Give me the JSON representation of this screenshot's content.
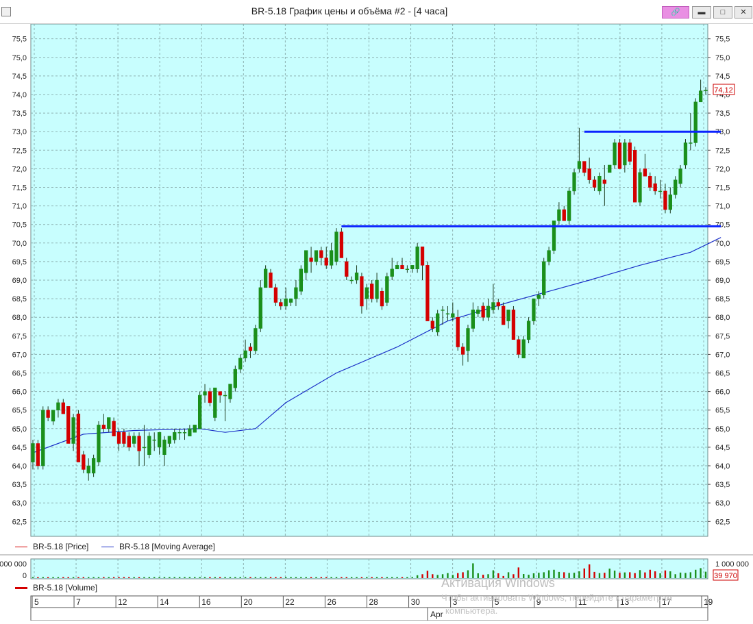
{
  "window": {
    "title": "BR-5.18 График цены и объёма #2 - [4 часа]",
    "link_icon": "link-icon",
    "min_icon": "minimize-icon",
    "max_icon": "maximize-icon",
    "close_icon": "close-icon"
  },
  "colors": {
    "plot_bg": "#c8fefe",
    "grid": "#7f9f9f",
    "up": "#1b8f1b",
    "down": "#d40000",
    "ma": "#1a2fc7",
    "level": "#0a22ff",
    "price_tag": "#cc0000"
  },
  "legend": {
    "price": "BR-5.18 [Price]",
    "ma": "BR-5.18 [Moving Average]",
    "volume": "BR-5.18 [Volume]"
  },
  "price_tag": "74,12",
  "volume_axis": {
    "top": "1 000 000",
    "zero": "0",
    "left_top": "000 000",
    "left_zero": "0"
  },
  "volume_tag": "39 970",
  "x_axis": {
    "labels": [
      "5",
      "7",
      "12",
      "14",
      "16",
      "20",
      "22",
      "26",
      "28",
      "30",
      "3",
      "5",
      "9",
      "11",
      "13",
      "17",
      "19"
    ],
    "month": "Apr"
  },
  "watermark": {
    "line1": "Активация Windows",
    "line2": "Чтобы активировать Windows, перейдите к параметрам",
    "line3": "компьютера."
  },
  "chart_data": {
    "type": "candlestick",
    "title": "BR-5.18 График цены и объёма #2 - [4 часа]",
    "ylim": [
      62.1,
      75.9
    ],
    "yticks": [
      "62,5",
      "63,0",
      "63,5",
      "64,0",
      "64,5",
      "65,0",
      "65,5",
      "66,0",
      "66,5",
      "67,0",
      "67,5",
      "68,0",
      "68,5",
      "69,0",
      "69,5",
      "70,0",
      "70,5",
      "71,0",
      "71,5",
      "72,0",
      "72,5",
      "73,0",
      "73,5",
      "74,0",
      "74,5",
      "75,0",
      "75,5"
    ],
    "grid": true,
    "candles": [
      {
        "o": 64.1,
        "h": 64.7,
        "l": 63.9,
        "c": 64.6
      },
      {
        "o": 64.6,
        "h": 64.7,
        "l": 63.9,
        "c": 64.0
      },
      {
        "o": 64.0,
        "h": 65.6,
        "l": 63.9,
        "c": 65.5
      },
      {
        "o": 65.5,
        "h": 65.6,
        "l": 65.2,
        "c": 65.3
      },
      {
        "o": 65.2,
        "h": 65.5,
        "l": 65.1,
        "c": 65.5
      },
      {
        "o": 65.5,
        "h": 65.8,
        "l": 65.3,
        "c": 65.7
      },
      {
        "o": 65.7,
        "h": 65.8,
        "l": 65.4,
        "c": 65.4
      },
      {
        "o": 65.6,
        "h": 65.6,
        "l": 64.6,
        "c": 64.6
      },
      {
        "o": 64.6,
        "h": 65.4,
        "l": 64.4,
        "c": 65.3
      },
      {
        "o": 65.4,
        "h": 65.5,
        "l": 64.1,
        "c": 64.1
      },
      {
        "o": 64.3,
        "h": 64.4,
        "l": 63.8,
        "c": 63.9
      },
      {
        "o": 63.8,
        "h": 64.2,
        "l": 63.6,
        "c": 64.0
      },
      {
        "o": 63.8,
        "h": 64.3,
        "l": 63.7,
        "c": 64.2
      },
      {
        "o": 64.1,
        "h": 65.2,
        "l": 64.0,
        "c": 65.1
      },
      {
        "o": 65.1,
        "h": 65.4,
        "l": 64.9,
        "c": 65.0
      },
      {
        "o": 65.0,
        "h": 65.3,
        "l": 64.9,
        "c": 65.3
      },
      {
        "o": 65.2,
        "h": 65.3,
        "l": 64.8,
        "c": 64.8
      },
      {
        "o": 64.9,
        "h": 65.0,
        "l": 64.4,
        "c": 64.6
      },
      {
        "o": 64.9,
        "h": 65.0,
        "l": 64.5,
        "c": 64.6
      },
      {
        "o": 64.8,
        "h": 64.9,
        "l": 64.4,
        "c": 64.5
      },
      {
        "o": 64.6,
        "h": 64.9,
        "l": 64.5,
        "c": 64.8
      },
      {
        "o": 64.8,
        "h": 64.9,
        "l": 64.0,
        "c": 64.4
      },
      {
        "o": 64.5,
        "h": 65.1,
        "l": 64.0,
        "c": 64.5
      },
      {
        "o": 64.3,
        "h": 64.9,
        "l": 64.2,
        "c": 64.8
      },
      {
        "o": 64.7,
        "h": 64.9,
        "l": 64.4,
        "c": 64.7
      },
      {
        "o": 64.5,
        "h": 64.9,
        "l": 64.3,
        "c": 64.9
      },
      {
        "o": 64.3,
        "h": 64.8,
        "l": 64.0,
        "c": 64.7
      },
      {
        "o": 64.6,
        "h": 64.8,
        "l": 64.5,
        "c": 64.8
      },
      {
        "o": 64.7,
        "h": 65.0,
        "l": 64.6,
        "c": 64.9
      },
      {
        "o": 64.9,
        "h": 65.0,
        "l": 64.7,
        "c": 64.9
      },
      {
        "o": 64.9,
        "h": 65.0,
        "l": 64.7,
        "c": 64.9
      },
      {
        "o": 64.8,
        "h": 65.1,
        "l": 64.8,
        "c": 65.0
      },
      {
        "o": 64.9,
        "h": 65.1,
        "l": 64.9,
        "c": 65.1
      },
      {
        "o": 65.0,
        "h": 66.0,
        "l": 65.0,
        "c": 65.9
      },
      {
        "o": 65.9,
        "h": 66.2,
        "l": 65.7,
        "c": 66.0
      },
      {
        "o": 66.0,
        "h": 66.1,
        "l": 65.6,
        "c": 65.7
      },
      {
        "o": 65.3,
        "h": 66.1,
        "l": 65.2,
        "c": 66.1
      },
      {
        "o": 66.0,
        "h": 66.0,
        "l": 65.7,
        "c": 65.9
      },
      {
        "o": 65.9,
        "h": 66.0,
        "l": 65.2,
        "c": 65.9
      },
      {
        "o": 65.8,
        "h": 66.2,
        "l": 65.7,
        "c": 66.2
      },
      {
        "o": 66.1,
        "h": 66.7,
        "l": 66.0,
        "c": 66.6
      },
      {
        "o": 66.6,
        "h": 67.0,
        "l": 66.5,
        "c": 66.9
      },
      {
        "o": 66.9,
        "h": 67.4,
        "l": 66.8,
        "c": 67.1
      },
      {
        "o": 67.2,
        "h": 67.3,
        "l": 66.9,
        "c": 67.1
      },
      {
        "o": 67.1,
        "h": 67.8,
        "l": 67.0,
        "c": 67.7
      },
      {
        "o": 67.7,
        "h": 69.0,
        "l": 67.6,
        "c": 68.8
      },
      {
        "o": 68.8,
        "h": 69.4,
        "l": 68.8,
        "c": 69.3
      },
      {
        "o": 69.2,
        "h": 69.3,
        "l": 68.8,
        "c": 68.8
      },
      {
        "o": 68.8,
        "h": 68.9,
        "l": 68.3,
        "c": 68.4
      },
      {
        "o": 68.4,
        "h": 68.5,
        "l": 68.2,
        "c": 68.3
      },
      {
        "o": 68.3,
        "h": 68.8,
        "l": 68.2,
        "c": 68.5
      },
      {
        "o": 68.4,
        "h": 68.5,
        "l": 68.3,
        "c": 68.5
      },
      {
        "o": 68.5,
        "h": 69.0,
        "l": 68.3,
        "c": 68.8
      },
      {
        "o": 68.7,
        "h": 69.4,
        "l": 68.6,
        "c": 69.3
      },
      {
        "o": 69.2,
        "h": 69.8,
        "l": 69.0,
        "c": 69.8
      },
      {
        "o": 69.6,
        "h": 69.9,
        "l": 69.2,
        "c": 69.5
      },
      {
        "o": 69.5,
        "h": 69.8,
        "l": 69.4,
        "c": 69.8
      },
      {
        "o": 69.8,
        "h": 69.9,
        "l": 69.4,
        "c": 69.6
      },
      {
        "o": 69.6,
        "h": 69.9,
        "l": 69.3,
        "c": 69.4
      },
      {
        "o": 69.4,
        "h": 70.0,
        "l": 69.3,
        "c": 69.8
      },
      {
        "o": 69.5,
        "h": 70.4,
        "l": 69.4,
        "c": 70.3
      },
      {
        "o": 70.3,
        "h": 70.4,
        "l": 69.6,
        "c": 69.6
      },
      {
        "o": 69.5,
        "h": 69.6,
        "l": 69.0,
        "c": 69.1
      },
      {
        "o": 69.0,
        "h": 69.1,
        "l": 68.9,
        "c": 69.0
      },
      {
        "o": 69.0,
        "h": 69.4,
        "l": 68.9,
        "c": 69.2
      },
      {
        "o": 69.1,
        "h": 69.2,
        "l": 68.1,
        "c": 68.3
      },
      {
        "o": 68.5,
        "h": 68.9,
        "l": 68.2,
        "c": 68.8
      },
      {
        "o": 68.9,
        "h": 69.0,
        "l": 68.4,
        "c": 68.5
      },
      {
        "o": 68.5,
        "h": 69.2,
        "l": 68.4,
        "c": 69.0
      },
      {
        "o": 68.7,
        "h": 68.8,
        "l": 68.2,
        "c": 68.3
      },
      {
        "o": 68.4,
        "h": 69.2,
        "l": 68.3,
        "c": 69.1
      },
      {
        "o": 69.1,
        "h": 69.6,
        "l": 69.0,
        "c": 69.3
      },
      {
        "o": 69.3,
        "h": 69.5,
        "l": 69.3,
        "c": 69.4
      },
      {
        "o": 69.4,
        "h": 69.6,
        "l": 69.3,
        "c": 69.3
      },
      {
        "o": 69.3,
        "h": 69.4,
        "l": 69.2,
        "c": 69.3
      },
      {
        "o": 69.3,
        "h": 69.4,
        "l": 69.2,
        "c": 69.4
      },
      {
        "o": 69.3,
        "h": 70.0,
        "l": 69.2,
        "c": 69.9
      },
      {
        "o": 69.9,
        "h": 69.9,
        "l": 69.0,
        "c": 69.4
      },
      {
        "o": 69.4,
        "h": 69.5,
        "l": 67.9,
        "c": 67.9
      },
      {
        "o": 67.9,
        "h": 68.0,
        "l": 67.6,
        "c": 67.7
      },
      {
        "o": 67.6,
        "h": 68.2,
        "l": 67.5,
        "c": 68.1
      },
      {
        "o": 68.2,
        "h": 68.3,
        "l": 67.8,
        "c": 68.2
      },
      {
        "o": 68.1,
        "h": 68.3,
        "l": 67.9,
        "c": 68.1
      },
      {
        "o": 68.0,
        "h": 68.4,
        "l": 67.9,
        "c": 68.1
      },
      {
        "o": 68.0,
        "h": 68.2,
        "l": 67.1,
        "c": 67.2
      },
      {
        "o": 67.2,
        "h": 67.3,
        "l": 66.7,
        "c": 67.0
      },
      {
        "o": 67.1,
        "h": 67.8,
        "l": 66.8,
        "c": 67.7
      },
      {
        "o": 67.7,
        "h": 68.4,
        "l": 67.6,
        "c": 68.2
      },
      {
        "o": 68.1,
        "h": 68.3,
        "l": 68.0,
        "c": 68.2
      },
      {
        "o": 68.3,
        "h": 68.4,
        "l": 67.9,
        "c": 68.0
      },
      {
        "o": 68.0,
        "h": 68.5,
        "l": 67.9,
        "c": 68.3
      },
      {
        "o": 68.2,
        "h": 68.9,
        "l": 68.1,
        "c": 68.4
      },
      {
        "o": 68.4,
        "h": 68.5,
        "l": 68.2,
        "c": 68.3
      },
      {
        "o": 68.3,
        "h": 68.4,
        "l": 67.8,
        "c": 67.8
      },
      {
        "o": 67.9,
        "h": 68.2,
        "l": 67.7,
        "c": 68.2
      },
      {
        "o": 68.2,
        "h": 68.3,
        "l": 67.4,
        "c": 67.4
      },
      {
        "o": 67.4,
        "h": 67.5,
        "l": 66.9,
        "c": 67.0
      },
      {
        "o": 66.9,
        "h": 67.5,
        "l": 66.9,
        "c": 67.4
      },
      {
        "o": 67.4,
        "h": 68.0,
        "l": 67.3,
        "c": 67.9
      },
      {
        "o": 67.9,
        "h": 68.5,
        "l": 67.8,
        "c": 68.5
      },
      {
        "o": 68.5,
        "h": 68.7,
        "l": 68.3,
        "c": 68.6
      },
      {
        "o": 68.6,
        "h": 69.6,
        "l": 68.5,
        "c": 69.5
      },
      {
        "o": 69.5,
        "h": 69.9,
        "l": 69.4,
        "c": 69.8
      },
      {
        "o": 69.8,
        "h": 70.6,
        "l": 69.7,
        "c": 70.6
      },
      {
        "o": 70.6,
        "h": 71.1,
        "l": 70.5,
        "c": 70.9
      },
      {
        "o": 70.9,
        "h": 71.0,
        "l": 70.6,
        "c": 70.6
      },
      {
        "o": 70.6,
        "h": 71.5,
        "l": 70.5,
        "c": 71.4
      },
      {
        "o": 71.4,
        "h": 72.0,
        "l": 71.3,
        "c": 71.9
      },
      {
        "o": 72.0,
        "h": 73.1,
        "l": 71.9,
        "c": 72.2
      },
      {
        "o": 72.2,
        "h": 72.2,
        "l": 71.8,
        "c": 71.9
      },
      {
        "o": 72.0,
        "h": 72.3,
        "l": 71.6,
        "c": 71.7
      },
      {
        "o": 71.7,
        "h": 71.8,
        "l": 71.4,
        "c": 71.5
      },
      {
        "o": 71.4,
        "h": 71.9,
        "l": 71.3,
        "c": 71.8
      },
      {
        "o": 71.7,
        "h": 72.1,
        "l": 71.0,
        "c": 71.6
      },
      {
        "o": 71.9,
        "h": 72.1,
        "l": 71.9,
        "c": 72.1
      },
      {
        "o": 72.1,
        "h": 72.8,
        "l": 72.0,
        "c": 72.7
      },
      {
        "o": 72.7,
        "h": 72.8,
        "l": 72.0,
        "c": 72.0
      },
      {
        "o": 72.1,
        "h": 72.8,
        "l": 71.9,
        "c": 72.7
      },
      {
        "o": 72.7,
        "h": 72.8,
        "l": 72.1,
        "c": 72.2
      },
      {
        "o": 72.5,
        "h": 72.6,
        "l": 71.1,
        "c": 71.1
      },
      {
        "o": 71.1,
        "h": 72.0,
        "l": 71.0,
        "c": 71.9
      },
      {
        "o": 72.0,
        "h": 72.4,
        "l": 71.8,
        "c": 71.8
      },
      {
        "o": 71.8,
        "h": 71.9,
        "l": 71.4,
        "c": 71.5
      },
      {
        "o": 71.6,
        "h": 71.8,
        "l": 71.3,
        "c": 71.4
      },
      {
        "o": 71.4,
        "h": 71.7,
        "l": 71.2,
        "c": 71.4
      },
      {
        "o": 71.4,
        "h": 71.6,
        "l": 70.8,
        "c": 70.9
      },
      {
        "o": 70.9,
        "h": 71.5,
        "l": 70.8,
        "c": 71.3
      },
      {
        "o": 71.3,
        "h": 71.8,
        "l": 71.2,
        "c": 71.7
      },
      {
        "o": 71.6,
        "h": 72.1,
        "l": 71.5,
        "c": 72.0
      },
      {
        "o": 72.1,
        "h": 72.8,
        "l": 72.0,
        "c": 72.7
      },
      {
        "o": 72.7,
        "h": 73.5,
        "l": 72.5,
        "c": 72.7
      },
      {
        "o": 72.7,
        "h": 73.9,
        "l": 72.6,
        "c": 73.8
      },
      {
        "o": 73.8,
        "h": 74.4,
        "l": 73.8,
        "c": 74.1
      },
      {
        "o": 74.1,
        "h": 74.2,
        "l": 74.0,
        "c": 74.12
      }
    ],
    "moving_average_knots": [
      [
        0,
        64.35
      ],
      [
        10,
        64.85
      ],
      [
        20,
        64.95
      ],
      [
        33,
        65.0
      ],
      [
        38,
        64.9
      ],
      [
        44,
        65.0
      ],
      [
        50,
        65.7
      ],
      [
        60,
        66.5
      ],
      [
        72,
        67.2
      ],
      [
        82,
        67.9
      ],
      [
        94,
        68.4
      ],
      [
        102,
        68.7
      ],
      [
        110,
        69.0
      ],
      [
        120,
        69.4
      ],
      [
        130,
        69.75
      ],
      [
        136,
        70.15
      ]
    ],
    "levels": [
      {
        "from_index": 61,
        "to_index": 136,
        "value": 70.45
      },
      {
        "from_index": 109,
        "to_index": 136,
        "value": 73.0
      }
    ],
    "volume": [
      0.03,
      0.02,
      0.04,
      0.02,
      0.02,
      0.03,
      0.02,
      0.04,
      0.02,
      0.03,
      0.02,
      0.02,
      0.03,
      0.03,
      0.02,
      0.02,
      0.03,
      0.02,
      0.02,
      0.02,
      0.02,
      0.03,
      0.02,
      0.02,
      0.02,
      0.02,
      0.02,
      0.02,
      0.02,
      0.02,
      0.02,
      0.02,
      0.02,
      0.03,
      0.02,
      0.02,
      0.02,
      0.02,
      0.02,
      0.02,
      0.02,
      0.02,
      0.02,
      0.02,
      0.02,
      0.03,
      0.04,
      0.02,
      0.03,
      0.02,
      0.02,
      0.02,
      0.02,
      0.02,
      0.03,
      0.02,
      0.02,
      0.02,
      0.02,
      0.02,
      0.03,
      0.02,
      0.02,
      0.02,
      0.02,
      0.03,
      0.02,
      0.02,
      0.02,
      0.03,
      0.03,
      0.02,
      0.02,
      0.02,
      0.02,
      0.02,
      0.16,
      0.22,
      0.41,
      0.22,
      0.18,
      0.22,
      0.28,
      0.18,
      0.28,
      0.33,
      0.44,
      0.83,
      0.27,
      0.19,
      0.22,
      0.44,
      0.27,
      0.12,
      0.33,
      0.22,
      0.6,
      0.23,
      0.19,
      0.27,
      0.3,
      0.33,
      0.44,
      0.47,
      0.35,
      0.33,
      0.29,
      0.3,
      0.38,
      0.54,
      0.77,
      0.35,
      0.28,
      0.3,
      0.53,
      0.42,
      0.3,
      0.32,
      0.33,
      0.28,
      0.45,
      0.32,
      0.47,
      0.38,
      0.27,
      0.43,
      0.38,
      0.22,
      0.31,
      0.29,
      0.33,
      0.47,
      0.56,
      0.36,
      0.55,
      0.4,
      0.05
    ]
  }
}
